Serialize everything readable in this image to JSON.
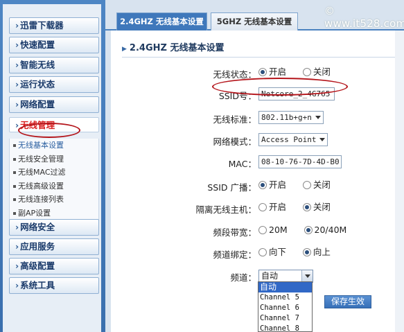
{
  "sidebar": {
    "items_top": [
      {
        "label": "迅雷下载器"
      },
      {
        "label": "快速配置"
      },
      {
        "label": "智能无线"
      },
      {
        "label": "运行状态"
      },
      {
        "label": "网络配置"
      }
    ],
    "active_item": {
      "label": "无线管理"
    },
    "submenu": [
      {
        "label": "无线基本设置",
        "active": true
      },
      {
        "label": "无线安全管理"
      },
      {
        "label": "无线MAC过滤"
      },
      {
        "label": "无线高级设置"
      },
      {
        "label": "无线连接列表"
      },
      {
        "label": "副AP设置"
      }
    ],
    "items_bottom": [
      {
        "label": "网络安全"
      },
      {
        "label": "应用服务"
      },
      {
        "label": "高级配置"
      },
      {
        "label": "系统工具"
      }
    ]
  },
  "tabs": {
    "active": "2.4GHZ 无线基本设置",
    "inactive": "5GHZ 无线基本设置"
  },
  "watermark": "© www.it528.com",
  "section_title": "2.4GHZ 无线基本设置",
  "form": {
    "wireless_status": {
      "label": "无线状态：",
      "on": "开启",
      "off": "关闭",
      "selected": "on"
    },
    "ssid": {
      "label": "SSID号：",
      "value": "Netcore_2_4G765"
    },
    "standard": {
      "label": "无线标准：",
      "value": "802.11b+g+n"
    },
    "mode": {
      "label": "网络模式：",
      "value": "Access Point"
    },
    "mac": {
      "label": "MAC：",
      "value": "08-10-76-7D-4D-B0"
    },
    "ssid_broadcast": {
      "label": "SSID 广播：",
      "on": "开启",
      "off": "关闭",
      "selected": "on"
    },
    "isolate": {
      "label": "隔离无线主机：",
      "on": "开启",
      "off": "关闭",
      "selected": "off"
    },
    "bandwidth": {
      "label": "频段带宽：",
      "a": "20M",
      "b": "20/40M",
      "selected": "b"
    },
    "channel_bind": {
      "label": "频道绑定：",
      "a": "向下",
      "b": "向上",
      "selected": "b"
    },
    "channel": {
      "label": "频道：",
      "value": "自动",
      "options": [
        "自动",
        "Channel 5",
        "Channel 6",
        "Channel 7",
        "Channel 8"
      ]
    }
  },
  "save_button": "保存生效",
  "colors": {
    "accent": "#3f78bb",
    "active_menu": "#d81f1f",
    "annotation": "#b4141a"
  }
}
